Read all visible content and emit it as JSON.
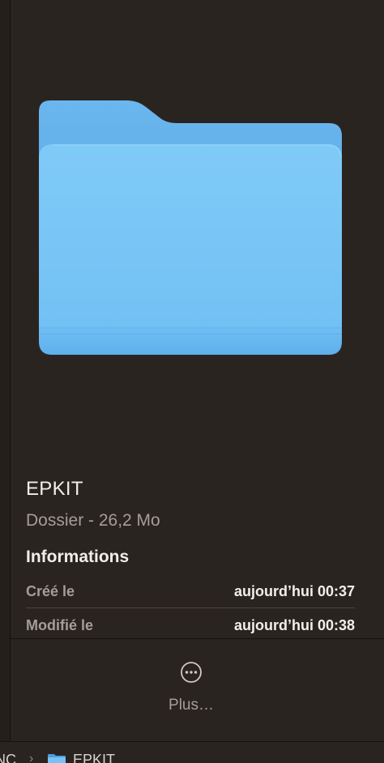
{
  "file": {
    "name": "EPKIT",
    "kind": "Dossier - 26,2 Mo"
  },
  "information": {
    "title": "Informations",
    "rows": [
      {
        "label": "Créé le",
        "value": "aujourd’hui 00:37"
      },
      {
        "label": "Modifié le",
        "value": "aujourd’hui 00:38"
      }
    ]
  },
  "actions": {
    "more_label": "Plus…"
  },
  "pathbar": {
    "previous": "NC",
    "separator": "›",
    "current": "EPKIT"
  },
  "icons": {
    "preview": "folder-icon",
    "more": "ellipsis-circle-icon",
    "pathbar_folder": "folder-icon"
  },
  "colors": {
    "background": "#2a2421",
    "folder_front": "#74c3f4",
    "folder_back": "#5aa8e6",
    "secondary_text": "#a49d98"
  }
}
